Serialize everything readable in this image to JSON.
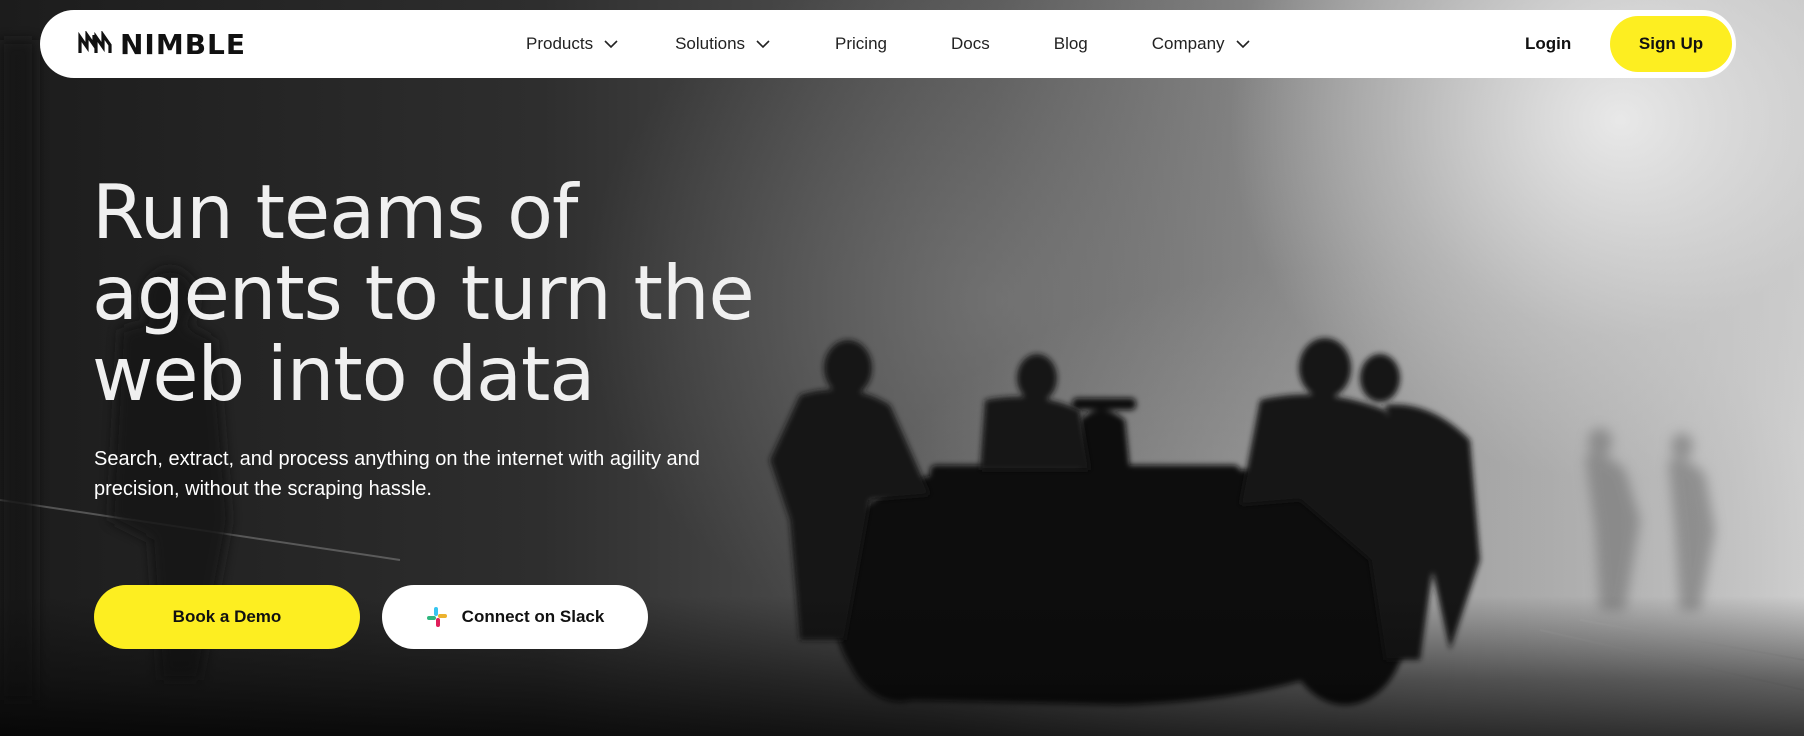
{
  "nav": {
    "brand": "NIMBLE",
    "links": [
      {
        "label": "Products",
        "dropdown": true
      },
      {
        "label": "Solutions",
        "dropdown": true
      },
      {
        "label": "Pricing",
        "dropdown": false
      },
      {
        "label": "Docs",
        "dropdown": false
      },
      {
        "label": "Blog",
        "dropdown": false
      },
      {
        "label": "Company",
        "dropdown": true
      }
    ],
    "login": "Login",
    "signup": "Sign Up"
  },
  "hero": {
    "headline": "Run teams of agents to turn the web into data",
    "subheadline": "Search, extract, and process anything on the internet with agility and precision, without the scraping hassle.",
    "primary_cta": "Book a Demo",
    "secondary_cta": "Connect on Slack",
    "background_image": "race-car-pit-crew-monochrome"
  },
  "colors": {
    "accent": "#fdee21",
    "nav_bg": "#ffffff",
    "text_dark": "#111111",
    "hero_text": "#f0f0f0"
  },
  "icons": {
    "logo": "nimble-logo-icon",
    "chevron": "chevron-down-icon",
    "slack": "slack-icon"
  }
}
